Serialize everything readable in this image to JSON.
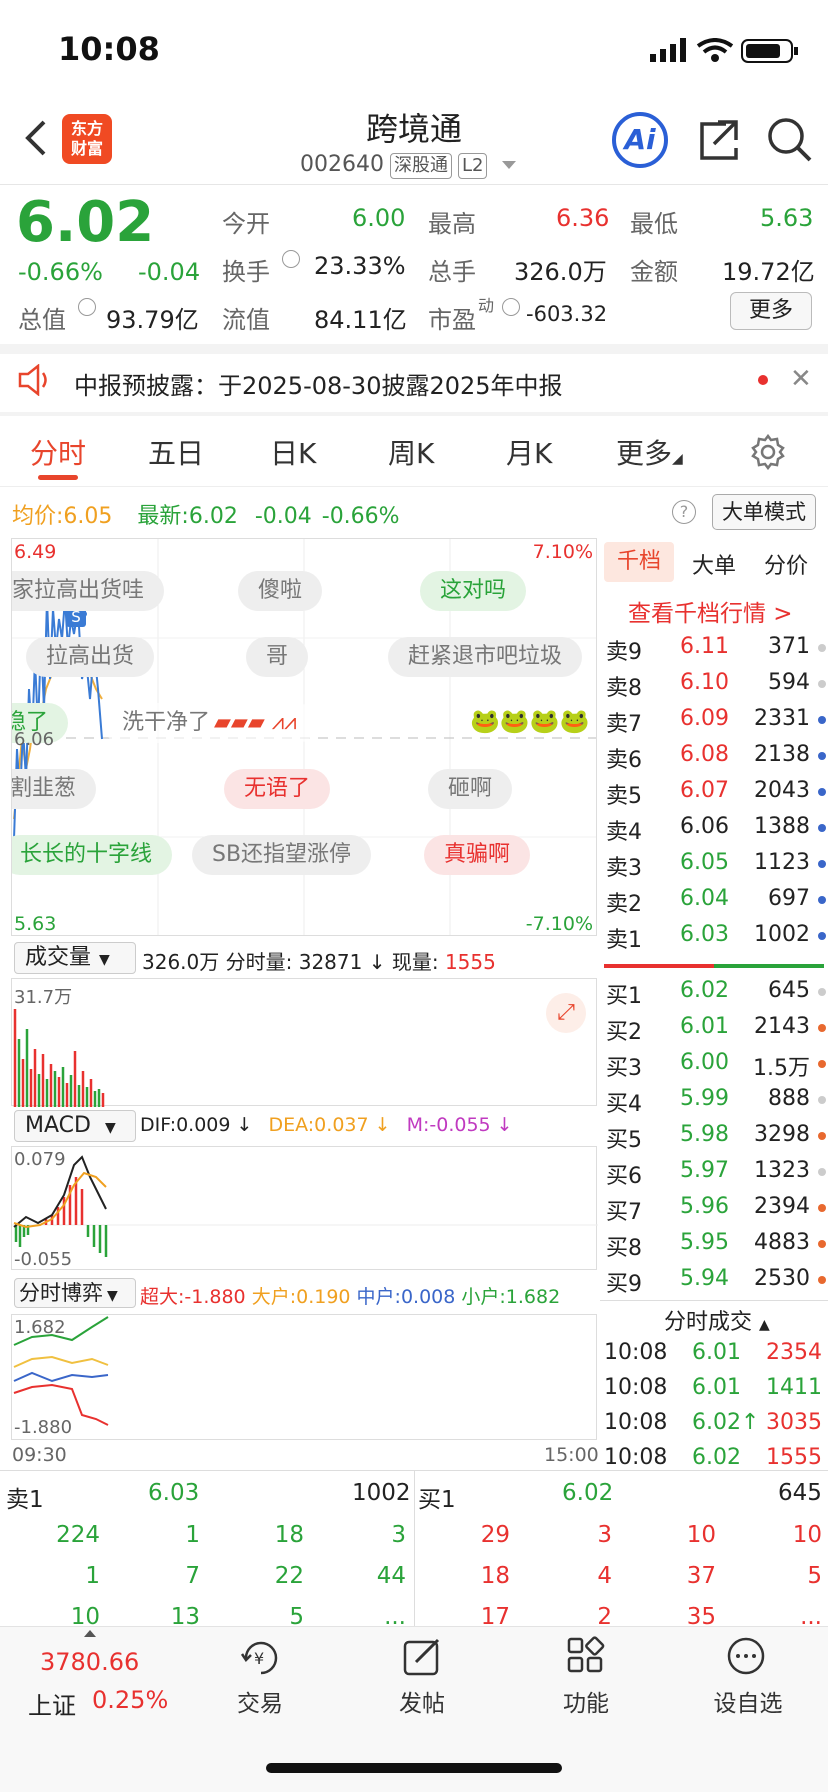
{
  "status": {
    "time": "10:08"
  },
  "header": {
    "logo": "东方财富",
    "title": "跨境通",
    "code": "002640",
    "tag1": "深股通",
    "tag2": "L2",
    "ai": "Ai"
  },
  "quote": {
    "price": "6.02",
    "pct": "-0.66%",
    "chg": "-0.04",
    "open_label": "今开",
    "open": "6.00",
    "high_label": "最高",
    "high": "6.36",
    "low_label": "最低",
    "low": "5.63",
    "turnover_label": "换手",
    "turnover": "23.33%",
    "vol_label": "总手",
    "vol": "326.0万",
    "amt_label": "金额",
    "amt": "19.72亿",
    "mcap_label": "总值",
    "mcap": "93.79亿",
    "float_label": "流值",
    "float": "84.11亿",
    "pe_label": "市盈",
    "pe_sup": "动",
    "pe": "-603.32",
    "more": "更多"
  },
  "notice": {
    "text": "中报预披露：于2025-08-30披露2025年中报"
  },
  "tabs": [
    "分时",
    "五日",
    "日K",
    "周K",
    "月K",
    "更多"
  ],
  "chart_info": {
    "avg_label": "均价:",
    "avg": "6.05",
    "latest_label": "最新:",
    "latest": "6.02",
    "chg": "-0.04",
    "pct": "-0.66%",
    "mode": "大单模式",
    "top_price": "6.49",
    "top_pct": "7.10%",
    "bottom_price": "5.63",
    "bottom_pct": "-7.10%",
    "ref_price": "6.06",
    "time_start": "09:30",
    "time_end": "15:00",
    "s_marker": "S"
  },
  "barrage": [
    "家拉高出货哇",
    "傻啦",
    "这对吗",
    "拉高出货",
    "哥",
    "赶紧退市吧垃圾",
    "稳了",
    "洗干净了",
    "割韭葱",
    "无语了",
    "砸啊",
    "长长的十字线",
    "SB还指望涨停",
    "真骗啊"
  ],
  "volume": {
    "label": "成交量",
    "total": "326.0万",
    "fen_label": "分时量:",
    "fen": "32871",
    "now_label": "现量:",
    "now": "1555",
    "max": "31.7万"
  },
  "macd": {
    "label": "MACD",
    "dif": "DIF:0.009",
    "dea": "DEA:0.037",
    "m": "M:-0.055",
    "max": "0.079",
    "min": "-0.055"
  },
  "game": {
    "label": "分时博弈",
    "super": "超大:-1.880",
    "big": "大户:0.190",
    "mid": "中户:0.008",
    "small": "小户:1.682",
    "max": "1.682",
    "min": "-1.880"
  },
  "orderbook": {
    "tabs": [
      "千档",
      "大单",
      "分价"
    ],
    "link": "查看千档行情 >",
    "sells": [
      {
        "l": "卖9",
        "p": "6.11",
        "v": "371"
      },
      {
        "l": "卖8",
        "p": "6.10",
        "v": "594"
      },
      {
        "l": "卖7",
        "p": "6.09",
        "v": "2331"
      },
      {
        "l": "卖6",
        "p": "6.08",
        "v": "2138"
      },
      {
        "l": "卖5",
        "p": "6.07",
        "v": "2043"
      },
      {
        "l": "卖4",
        "p": "6.06",
        "v": "1388"
      },
      {
        "l": "卖3",
        "p": "6.05",
        "v": "1123"
      },
      {
        "l": "卖2",
        "p": "6.04",
        "v": "697"
      },
      {
        "l": "卖1",
        "p": "6.03",
        "v": "1002"
      }
    ],
    "buys": [
      {
        "l": "买1",
        "p": "6.02",
        "v": "645"
      },
      {
        "l": "买2",
        "p": "6.01",
        "v": "2143"
      },
      {
        "l": "买3",
        "p": "6.00",
        "v": "1.5万"
      },
      {
        "l": "买4",
        "p": "5.99",
        "v": "888"
      },
      {
        "l": "买5",
        "p": "5.98",
        "v": "3298"
      },
      {
        "l": "买6",
        "p": "5.97",
        "v": "1323"
      },
      {
        "l": "买7",
        "p": "5.96",
        "v": "2394"
      },
      {
        "l": "买8",
        "p": "5.95",
        "v": "4883"
      },
      {
        "l": "买9",
        "p": "5.94",
        "v": "2530"
      }
    ],
    "ticks_label": "分时成交",
    "ticks": [
      {
        "t": "10:08",
        "p": "6.01",
        "v": "2354"
      },
      {
        "t": "10:08",
        "p": "6.01",
        "v": "1411"
      },
      {
        "t": "10:08",
        "p": "6.02↑",
        "v": "3035"
      },
      {
        "t": "10:08",
        "p": "6.02",
        "v": "1555"
      }
    ]
  },
  "queue": {
    "sell_label": "卖1",
    "sell_price": "6.03",
    "sell_vol": "1002",
    "buy_label": "买1",
    "buy_price": "6.02",
    "buy_vol": "645",
    "sell_rows": [
      [
        "224",
        "1",
        "18",
        "3"
      ],
      [
        "1",
        "7",
        "22",
        "44"
      ],
      [
        "10",
        "13",
        "5",
        "..."
      ]
    ],
    "buy_rows": [
      [
        "29",
        "3",
        "10",
        "10"
      ],
      [
        "18",
        "4",
        "37",
        "5"
      ],
      [
        "17",
        "2",
        "35",
        "..."
      ]
    ]
  },
  "bottom": {
    "index_val": "3780.66",
    "index_name": "上证",
    "index_pct": "0.25%",
    "items": [
      "交易",
      "发帖",
      "功能",
      "设自选"
    ]
  }
}
